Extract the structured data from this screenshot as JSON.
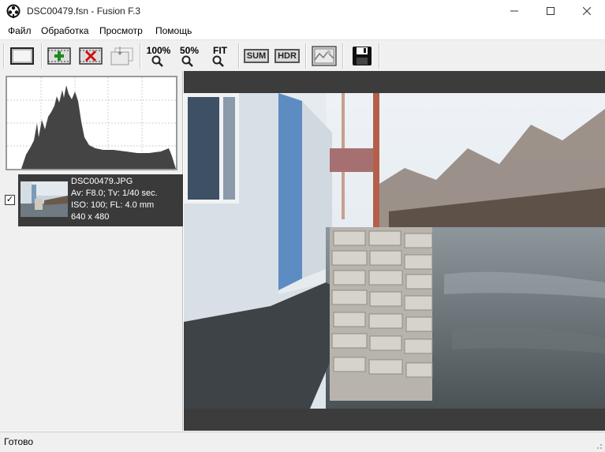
{
  "window": {
    "title": "DSC00479.fsn - Fusion F.3",
    "controls": [
      "minimize",
      "maximize",
      "close"
    ]
  },
  "menu": {
    "items": [
      "Файл",
      "Обработка",
      "Просмотр",
      "Помощь"
    ]
  },
  "toolbar": {
    "zoom100_label": "100%",
    "zoom50_label": "50%",
    "fit_label": "FIT",
    "sum_label": "SUM",
    "hdr_label": "HDR",
    "icons": [
      "view-frame-icon",
      "add-image-icon",
      "remove-image-icon",
      "align-icon",
      "zoom-100-icon",
      "zoom-50-icon",
      "zoom-fit-icon",
      "sum-icon",
      "hdr-icon",
      "image-settings-icon",
      "save-icon"
    ]
  },
  "thumbnail": {
    "checked": true,
    "filename": "DSC00479.JPG",
    "exposure": "Av: F8.0; Tv: 1/40 sec.",
    "iso_fl": "ISO: 100; FL: 4.0 mm",
    "dimensions": "640 x 480"
  },
  "status": {
    "text": "Готово"
  }
}
